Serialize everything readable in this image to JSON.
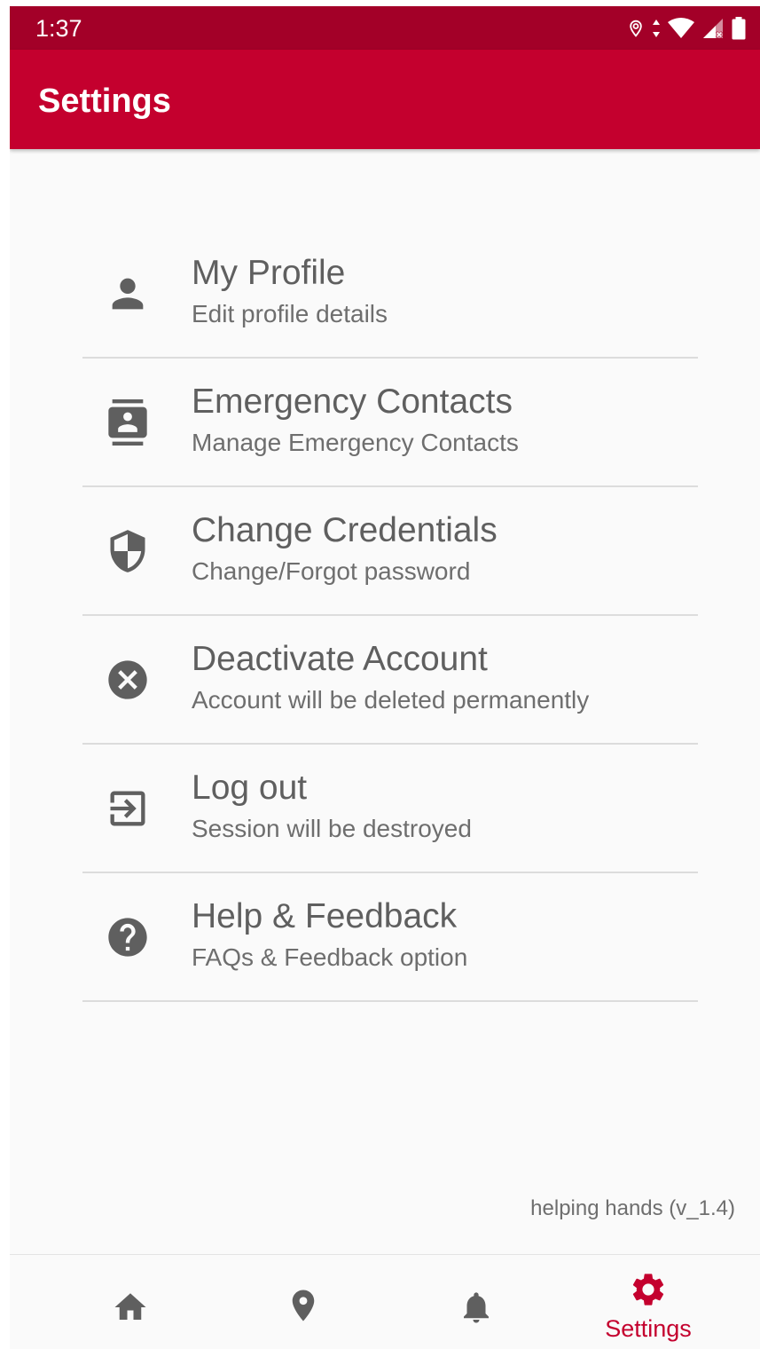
{
  "status_bar": {
    "time": "1:37",
    "icons": [
      "location-icon",
      "data-arrows-icon",
      "wifi-icon",
      "cell-signal-icon",
      "battery-icon"
    ]
  },
  "app_bar": {
    "title": "Settings"
  },
  "menu": {
    "items": [
      {
        "title": "My Profile",
        "subtitle": "Edit profile details",
        "icon": "person-icon"
      },
      {
        "title": "Emergency Contacts",
        "subtitle": "Manage Emergency Contacts",
        "icon": "contacts-icon"
      },
      {
        "title": "Change Credentials",
        "subtitle": "Change/Forgot password",
        "icon": "shield-icon"
      },
      {
        "title": "Deactivate Account",
        "subtitle": "Account will be deleted permanently",
        "icon": "cancel-icon"
      },
      {
        "title": "Log out",
        "subtitle": "Session will be destroyed",
        "icon": "logout-icon"
      },
      {
        "title": "Help & Feedback",
        "subtitle": "FAQs & Feedback option",
        "icon": "help-icon"
      }
    ]
  },
  "footer": {
    "version": "helping hands (v_1.4)"
  },
  "bottom_nav": {
    "items": [
      {
        "icon": "home-icon",
        "label": ""
      },
      {
        "icon": "location-pin-icon",
        "label": ""
      },
      {
        "icon": "bell-icon",
        "label": ""
      },
      {
        "icon": "gear-icon",
        "label": "Settings",
        "active": true
      }
    ]
  },
  "colors": {
    "status_bar": "#a30028",
    "app_bar": "#c4002e",
    "accent": "#c4002e",
    "icon": "#5f5f5f",
    "title_text": "#5f5f5f",
    "subtitle_text": "#6e6e6e",
    "background": "#fafafa",
    "divider": "#dcdcdc"
  }
}
